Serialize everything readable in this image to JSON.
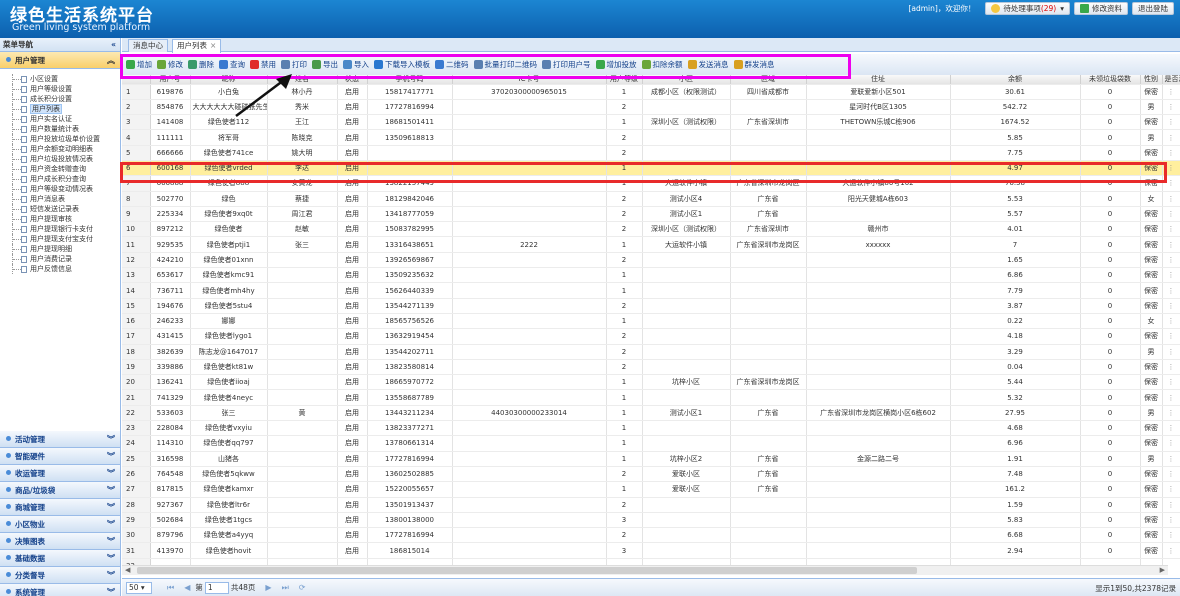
{
  "header": {
    "title": "绿色生活系统平台",
    "subtitle": "Green living system platform",
    "user_text": "[admin]，欢迎你！",
    "pending_label": "待处理事项",
    "pending_count": "(29)",
    "edit_profile": "修改资料",
    "logout": "退出登陆"
  },
  "sidebar": {
    "title": "菜单导航",
    "collapse_icon": "«",
    "open_section": "用户管理",
    "items": [
      "小区设置",
      "用户等级设置",
      "成长积分设置",
      "用户列表",
      "用户实名认证",
      "用户数量统计表",
      "用户投放垃圾单价设置",
      "用户余额变动明细表",
      "用户垃圾投放情况表",
      "用户资金转赠查询",
      "用户成长积分查询",
      "用户等级变动情况表",
      "用户消息表",
      "短信发送记录表",
      "用户提现审核",
      "用户提现银行卡支付",
      "用户提现支付宝支付",
      "用户提现明细",
      "用户消费记录",
      "用户反馈信息"
    ],
    "sections": [
      "活动管理",
      "智能硬件",
      "收运管理",
      "商品/垃圾袋",
      "商城管理",
      "小区物业",
      "决策图表",
      "基础数据",
      "分类督导",
      "系统管理"
    ]
  },
  "tabs": [
    {
      "label": "消息中心"
    },
    {
      "label": "用户列表"
    }
  ],
  "toolbar": [
    {
      "label": "增加",
      "color": "#3aa84a"
    },
    {
      "label": "修改",
      "color": "#6aa63a"
    },
    {
      "label": "删除",
      "color": "#3a9a6a"
    },
    {
      "label": "查询",
      "color": "#3a7ad0"
    },
    {
      "label": "禁用",
      "color": "#e02a2a"
    },
    {
      "label": "打印",
      "color": "#5a7fb0"
    },
    {
      "label": "导出",
      "color": "#4a9a4a"
    },
    {
      "label": "导入",
      "color": "#4a88c8"
    },
    {
      "label": "下载导入模板",
      "color": "#2a78d0"
    },
    {
      "label": "二维码",
      "color": "#3a7ad0"
    },
    {
      "label": "批量打印二维码",
      "color": "#5a7fb0"
    },
    {
      "label": "打印用户号",
      "color": "#5a7fb0"
    },
    {
      "label": "增加投放",
      "color": "#3aa84a"
    },
    {
      "label": "扣除余额",
      "color": "#6aa63a"
    },
    {
      "label": "发送消息",
      "color": "#d8a020"
    },
    {
      "label": "群发消息",
      "color": "#d8a020"
    }
  ],
  "table": {
    "columns": [
      "",
      "用户号",
      "昵称",
      "姓名",
      "状态",
      "手机号码",
      "IC卡号",
      "用户等级",
      "小区",
      "区域",
      "住址",
      "余额",
      "未领垃圾袋数",
      "性别",
      "是否满袋"
    ],
    "rows": [
      [
        "1",
        "619876",
        "小白兔",
        "林小丹",
        "启用",
        "15817417771",
        "37020300000965015",
        "1",
        "成都小区（权限测试）",
        "四川省成都市",
        "爱联爱新小区501",
        "30.61",
        "0",
        "保密",
        "⋮"
      ],
      [
        "2",
        "854876",
        "大大大大大大碰碰张先生",
        "秀米",
        "启用",
        "17727816994",
        "",
        "2",
        "",
        "",
        "星河时代B区1305",
        "542.72",
        "0",
        "男",
        "⋮"
      ],
      [
        "3",
        "141408",
        "绿色使者112",
        "王江",
        "启用",
        "18681501411",
        "",
        "1",
        "深圳小区（测试权限）",
        "广东省深圳市",
        "THETOWN乐城C栋906",
        "1674.52",
        "0",
        "保密",
        "⋮"
      ],
      [
        "4",
        "111111",
        "将军哥",
        "陈晓克",
        "启用",
        "13509618813",
        "",
        "2",
        "",
        "",
        "",
        "5.85",
        "0",
        "男",
        "⋮"
      ],
      [
        "5",
        "666666",
        "绿色使者741ce",
        "姚大明",
        "启用",
        "",
        "",
        "2",
        "",
        "",
        "",
        "7.75",
        "0",
        "保密",
        "⋮"
      ],
      [
        "6",
        "600168",
        "绿色使者vrded",
        "李达",
        "启用",
        "",
        "",
        "1",
        "",
        "",
        "",
        "4.97",
        "0",
        "保密",
        "⋮"
      ],
      [
        "7",
        "666888",
        "绿色使者888",
        "安黄龙",
        "启用",
        "13822157449",
        "",
        "1",
        "大运软件小镇",
        "广东省深圳市龙岗区",
        "大运软件小镇80号102",
        "76.58",
        "0",
        "保密",
        "⋮"
      ],
      [
        "8",
        "502770",
        "绿色",
        "蔡捷",
        "启用",
        "18129842046",
        "",
        "2",
        "测试小区4",
        "广东省",
        "阳光天健城A栋603",
        "5.53",
        "0",
        "女",
        "⋮"
      ],
      [
        "9",
        "225334",
        "绿色使者9xq0t",
        "周江君",
        "启用",
        "13418777059",
        "",
        "2",
        "测试小区1",
        "广东省",
        "",
        "5.57",
        "0",
        "保密",
        "⋮"
      ],
      [
        "10",
        "897212",
        "绿色使者",
        "赵敏",
        "启用",
        "15083782995",
        "",
        "2",
        "深圳小区（测试权限）",
        "广东省深圳市",
        "赣州市",
        "4.01",
        "0",
        "保密",
        "⋮"
      ],
      [
        "11",
        "929535",
        "绿色使者ptji1",
        "张三",
        "启用",
        "13316438651",
        "2222",
        "1",
        "大运软件小镇",
        "广东省深圳市龙岗区",
        "xxxxxx",
        "7",
        "0",
        "保密",
        "⋮"
      ],
      [
        "12",
        "424210",
        "绿色使者01xnn",
        "",
        "启用",
        "13926569867",
        "",
        "2",
        "",
        "",
        "",
        "1.65",
        "0",
        "保密",
        "⋮"
      ],
      [
        "13",
        "653617",
        "绿色使者kmc91",
        "",
        "启用",
        "13509235632",
        "",
        "1",
        "",
        "",
        "",
        "6.86",
        "0",
        "保密",
        "⋮"
      ],
      [
        "14",
        "736711",
        "绿色使者mh4hy",
        "",
        "启用",
        "15626440339",
        "",
        "1",
        "",
        "",
        "",
        "7.79",
        "0",
        "保密",
        "⋮"
      ],
      [
        "15",
        "194676",
        "绿色使者5stu4",
        "",
        "启用",
        "13544271139",
        "",
        "2",
        "",
        "",
        "",
        "3.87",
        "0",
        "保密",
        "⋮"
      ],
      [
        "16",
        "246233",
        "娜娜",
        "",
        "启用",
        "18565756526",
        "",
        "1",
        "",
        "",
        "",
        "0.22",
        "0",
        "女",
        "⋮"
      ],
      [
        "17",
        "431415",
        "绿色使者lygo1",
        "",
        "启用",
        "13632919454",
        "",
        "2",
        "",
        "",
        "",
        "4.18",
        "0",
        "保密",
        "⋮"
      ],
      [
        "18",
        "382639",
        "陈志龙@1647017",
        "",
        "启用",
        "13544202711",
        "",
        "2",
        "",
        "",
        "",
        "3.29",
        "0",
        "男",
        "⋮"
      ],
      [
        "19",
        "339886",
        "绿色使者kt81w",
        "",
        "启用",
        "13823580814",
        "",
        "2",
        "",
        "",
        "",
        "0.04",
        "0",
        "保密",
        "⋮"
      ],
      [
        "20",
        "136241",
        "绿色使者iioaj",
        "",
        "启用",
        "18665970772",
        "",
        "1",
        "坑梓小区",
        "广东省深圳市龙岗区",
        "",
        "5.44",
        "0",
        "保密",
        "⋮"
      ],
      [
        "21",
        "741329",
        "绿色使者4neyc",
        "",
        "启用",
        "13558687789",
        "",
        "1",
        "",
        "",
        "",
        "5.32",
        "0",
        "保密",
        "⋮"
      ],
      [
        "22",
        "533603",
        "张三",
        "黄",
        "启用",
        "13443211234",
        "44030300000233014",
        "1",
        "测试小区1",
        "广东省",
        "广东省深圳市龙岗区横岗小区6栋602",
        "27.95",
        "0",
        "男",
        "⋮"
      ],
      [
        "23",
        "228084",
        "绿色使者vxyiu",
        "",
        "启用",
        "13823377271",
        "",
        "1",
        "",
        "",
        "",
        "4.68",
        "0",
        "保密",
        "⋮"
      ],
      [
        "24",
        "114310",
        "绿色使者qq797",
        "",
        "启用",
        "13780661314",
        "",
        "1",
        "",
        "",
        "",
        "6.96",
        "0",
        "保密",
        "⋮"
      ],
      [
        "25",
        "316598",
        "山猪各",
        "",
        "启用",
        "17727816994",
        "",
        "1",
        "坑梓小区2",
        "广东省",
        "金源二路二号",
        "1.91",
        "0",
        "男",
        "⋮"
      ],
      [
        "26",
        "764548",
        "绿色使者5qkww",
        "",
        "启用",
        "13602502885",
        "",
        "2",
        "爱联小区",
        "广东省",
        "",
        "7.48",
        "0",
        "保密",
        "⋮"
      ],
      [
        "27",
        "817815",
        "绿色使者kamxr",
        "",
        "启用",
        "15220055657",
        "",
        "1",
        "爱联小区",
        "广东省",
        "",
        "161.2",
        "0",
        "保密",
        "⋮"
      ],
      [
        "28",
        "927367",
        "绿色使者ltr6r",
        "",
        "启用",
        "13501913437",
        "",
        "2",
        "",
        "",
        "",
        "1.59",
        "0",
        "保密",
        "⋮"
      ],
      [
        "29",
        "502684",
        "绿色使者1tgcs",
        "",
        "启用",
        "13800138000",
        "",
        "3",
        "",
        "",
        "",
        "5.83",
        "0",
        "保密",
        "⋮"
      ],
      [
        "30",
        "879796",
        "绿色使者a4yyq",
        "",
        "启用",
        "17727816994",
        "",
        "2",
        "",
        "",
        "",
        "6.68",
        "0",
        "保密",
        "⋮"
      ],
      [
        "31",
        "413970",
        "绿色使者hovit",
        "",
        "启用",
        "186815014",
        "",
        "3",
        "",
        "",
        "",
        "2.94",
        "0",
        "保密",
        "⋮"
      ],
      [
        "32",
        "",
        "",
        "",
        "",
        "",
        "",
        "",
        "",
        "",
        "",
        "",
        "",
        "",
        ""
      ]
    ]
  },
  "pager": {
    "page_size": "50",
    "page_label": "第",
    "page_value": "1",
    "total_pages": "共48页",
    "info": "显示1到50,共2378记录"
  }
}
